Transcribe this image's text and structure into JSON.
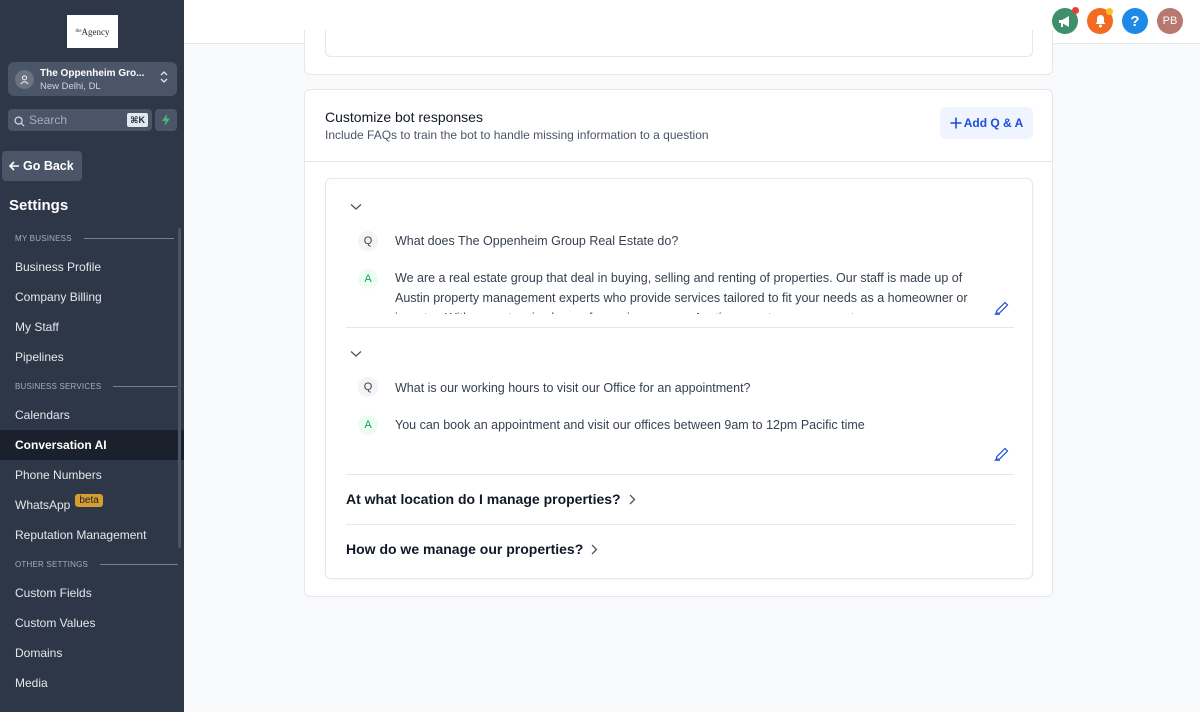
{
  "sidebar": {
    "logo_text": "Agency",
    "location": {
      "name": "The Oppenheim Gro...",
      "city": "New Delhi, DL"
    },
    "search": {
      "placeholder": "Search",
      "shortcut": "⌘K"
    },
    "go_back": "Go Back",
    "settings_title": "Settings",
    "sections": [
      {
        "label": "MY BUSINESS",
        "items": [
          "Business Profile",
          "Company Billing",
          "My Staff",
          "Pipelines"
        ]
      },
      {
        "label": "BUSINESS SERVICES",
        "items": [
          "Calendars",
          "Conversation AI",
          "Phone Numbers",
          "WhatsApp",
          "Reputation Management"
        ]
      },
      {
        "label": "OTHER SETTINGS",
        "items": [
          "Custom Fields",
          "Custom Values",
          "Domains",
          "Media"
        ]
      }
    ],
    "active_item": "Conversation AI",
    "beta_badge": "beta"
  },
  "header": {
    "avatar_initials": "PB",
    "help_label": "?",
    "colors": {
      "announce": "#3f8f6b",
      "bell": "#f26b21",
      "help": "#1d8ae8",
      "avatar": "#b8776f",
      "notif_dot": "#e53e3e"
    }
  },
  "bot_responses": {
    "title": "Customize bot responses",
    "subtitle": "Include FAQs to train the bot to handle missing information to a question",
    "add_button": "Add Q & A",
    "q_badge": "Q",
    "a_badge": "A",
    "faqs": [
      {
        "question": "What does The Oppenheim Group Real Estate do?",
        "answer": "We are a real estate group that deal in buying, selling and renting of properties. Our staff is made up of Austin property management experts who provide services tailored to fit your needs as a homeowner or investor. With our extensive base of experience as an Austin property management company"
      },
      {
        "question": "What is our working hours to visit our Office for an appointment?",
        "answer": "You can book an appointment and visit our offices between 9am to 12pm Pacific time"
      }
    ],
    "collapsed": [
      "At what location do I manage properties?",
      "How do we manage our properties?"
    ]
  }
}
